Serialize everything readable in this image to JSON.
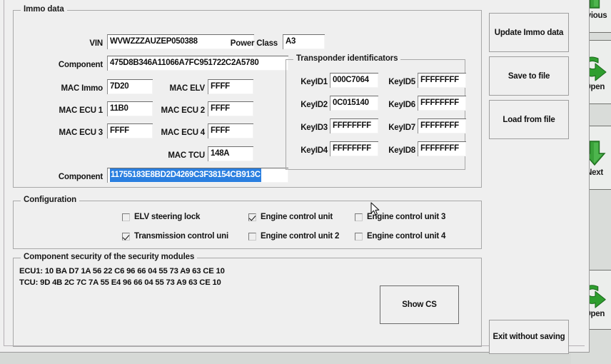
{
  "immo": {
    "group_title": "Immo data",
    "vin_label": "VIN",
    "vin_value": "WVWZZZAUZEP050388",
    "power_class_label": "Power Class",
    "power_class_value": "A3",
    "component1_label": "Component",
    "component1_value": "475D8B346A11066A7FC951722C2A5780",
    "mac_immo_label": "MAC Immo",
    "mac_immo_value": "7D20",
    "mac_elv_label": "MAC ELV",
    "mac_elv_value": "FFFF",
    "mac_ecu1_label": "MAC ECU 1",
    "mac_ecu1_value": "11B0",
    "mac_ecu2_label": "MAC ECU 2",
    "mac_ecu2_value": "FFFF",
    "mac_ecu3_label": "MAC ECU 3",
    "mac_ecu3_value": "FFFF",
    "mac_ecu4_label": "MAC ECU 4",
    "mac_ecu4_value": "FFFF",
    "mac_tcu_label": "MAC TCU",
    "mac_tcu_value": "148A",
    "component2_label": "Component",
    "component2_value": "11755183E8BD2D4269C3F38154CB913C",
    "component2_selected": true
  },
  "transponder": {
    "group_title": "Transponder identificators",
    "keys": [
      {
        "label": "KeyID1",
        "value": "000C7064"
      },
      {
        "label": "KeyID2",
        "value": "0C015140"
      },
      {
        "label": "KeyID3",
        "value": "FFFFFFFF"
      },
      {
        "label": "KeyID4",
        "value": "FFFFFFFF"
      },
      {
        "label": "KeyID5",
        "value": "FFFFFFFF"
      },
      {
        "label": "KeyID6",
        "value": "FFFFFFFF"
      },
      {
        "label": "KeyID7",
        "value": "FFFFFFFF"
      },
      {
        "label": "KeyID8",
        "value": "FFFFFFFF"
      }
    ]
  },
  "configuration": {
    "group_title": "Configuration",
    "items": [
      {
        "label": "ELV steering lock",
        "checked": false
      },
      {
        "label": "Transmission control uni",
        "checked": true
      },
      {
        "label": "Engine control unit",
        "checked": true
      },
      {
        "label": "Engine control unit 2",
        "checked": false
      },
      {
        "label": "Engine control unit 3",
        "checked": false
      },
      {
        "label": "Engine control unit 4",
        "checked": false
      }
    ]
  },
  "component_security": {
    "group_title": "Component security of the security modules",
    "ecu1_line": "ECU1: 10 BA D7 1A 56 22 C6 96 66 04 55 73 A9 63 CE 10",
    "tcu_line": "TCU: 9D 4B 2C 7C 7A 55 E4 96 66 04 55 73 A9 63 CE 10",
    "show_cs_label": "Show CS"
  },
  "actions": {
    "update_immo_label": "Update Immo data",
    "save_to_file_label": "Save to file",
    "load_from_file_label": "Load from file",
    "exit_label": "Exit without saving"
  },
  "navigation": {
    "previous_label": "evious",
    "open_label_1": "Open",
    "next_label": "Next",
    "open_label_2": "Open"
  },
  "colors": {
    "window_face": "#efefef",
    "selection_blue": "#2a7fe0",
    "nav_green": "#2f9e2f",
    "desktop": "#d9dcd9"
  }
}
